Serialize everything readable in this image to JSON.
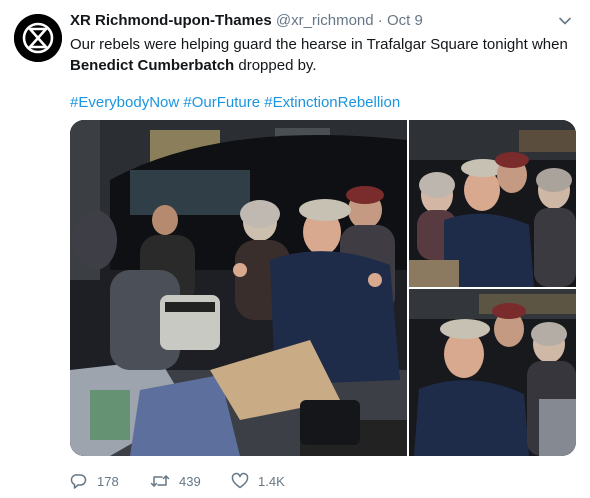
{
  "tweet": {
    "author_name": "XR Richmond-upon-Thames",
    "handle": "@xr_richmond",
    "separator": "·",
    "date": "Oct 9",
    "text_line1": "Our rebels were helping guard the hearse in Trafalgar Square tonight when",
    "text_bold": "Benedict Cumberbatch",
    "text_after_bold": " dropped by.",
    "hashtags": [
      "#EverybodyNow",
      "#OurFuture",
      "#ExtinctionRebellion"
    ],
    "icons": {
      "avatar": "extinction-rebellion-logo",
      "menu": "chevron-down-icon",
      "reply": "reply-icon",
      "retweet": "retweet-icon",
      "like": "heart-icon"
    }
  },
  "media": {
    "photo_count": 3
  },
  "actions": {
    "replies": "178",
    "retweets": "439",
    "likes": "1.4K"
  },
  "colors": {
    "link": "#1b95e0",
    "muted": "#657786",
    "text": "#14171a"
  }
}
